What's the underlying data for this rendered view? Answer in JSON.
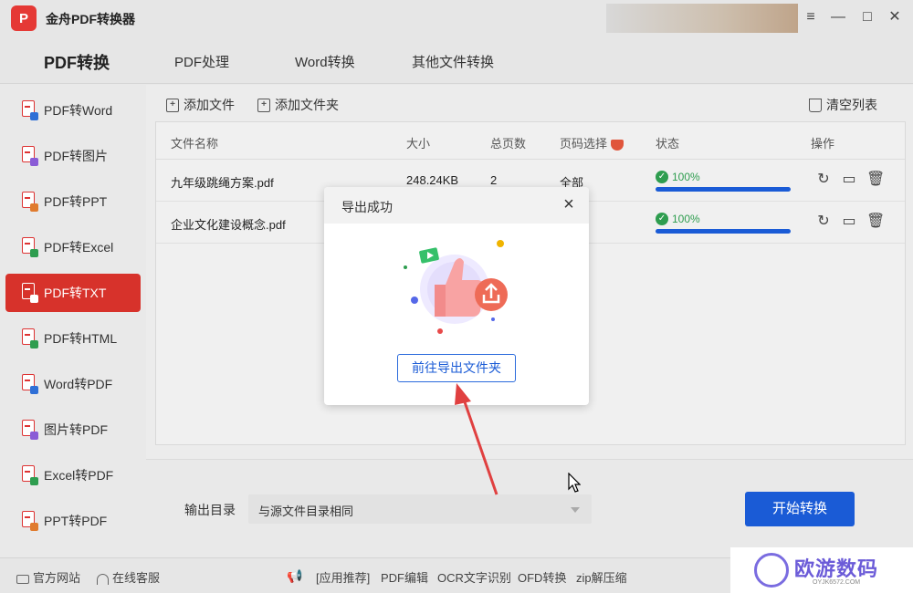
{
  "app": {
    "logo_text": "P",
    "title": "金舟PDF转换器",
    "window_controls": [
      "≡",
      "—",
      "□",
      "✕"
    ]
  },
  "topnav": {
    "items": [
      "PDF转换",
      "PDF处理",
      "Word转换",
      "其他文件转换"
    ],
    "active": "PDF转换"
  },
  "sidebar": {
    "items": [
      {
        "label": "PDF转Word",
        "tag_color": "#2f6fd6"
      },
      {
        "label": "PDF转图片",
        "tag_color": "#8a5cd6"
      },
      {
        "label": "PDF转PPT",
        "tag_color": "#e07b2e"
      },
      {
        "label": "PDF转Excel",
        "tag_color": "#2e9d4f"
      },
      {
        "label": "PDF转TXT",
        "tag_color": "#ffffff"
      },
      {
        "label": "PDF转HTML",
        "tag_color": "#2e9d4f"
      },
      {
        "label": "Word转PDF",
        "tag_color": "#2f6fd6"
      },
      {
        "label": "图片转PDF",
        "tag_color": "#8a5cd6"
      },
      {
        "label": "Excel转PDF",
        "tag_color": "#2e9d4f"
      },
      {
        "label": "PPT转PDF",
        "tag_color": "#e07b2e"
      }
    ],
    "active": "PDF转TXT"
  },
  "toolbar": {
    "add_file": "添加文件",
    "add_folder": "添加文件夹",
    "clear_list": "清空列表"
  },
  "table": {
    "columns": [
      "文件名称",
      "大小",
      "总页数",
      "页码选择",
      "状态",
      "操作"
    ],
    "rows": [
      {
        "name": "九年级跳绳方案.pdf",
        "size": "248.24KB",
        "pages": "2",
        "range": "全部",
        "progress_text": "100%",
        "progress": 1.0
      },
      {
        "name": "企业文化建设概念.pdf",
        "size": "",
        "pages": "",
        "range": "",
        "progress_text": "100%",
        "progress": 1.0
      }
    ]
  },
  "output": {
    "label": "输出目录",
    "value": "与源文件目录相同",
    "start_button": "开始转换"
  },
  "bottombar": {
    "official_site": "官方网站",
    "online_service": "在线客服",
    "links": [
      "[应用推荐]",
      "PDF编辑",
      "OCR文字识别",
      "OFD转换",
      "zip解压缩"
    ]
  },
  "modal": {
    "title": "导出成功",
    "button": "前往导出文件夹"
  },
  "watermark": {
    "text": "欧游数码",
    "sub": "OYJK6572.COM"
  },
  "colors": {
    "accent_red": "#d7322b",
    "primary_blue": "#1a5bd6",
    "success_green": "#2e9d4f"
  }
}
